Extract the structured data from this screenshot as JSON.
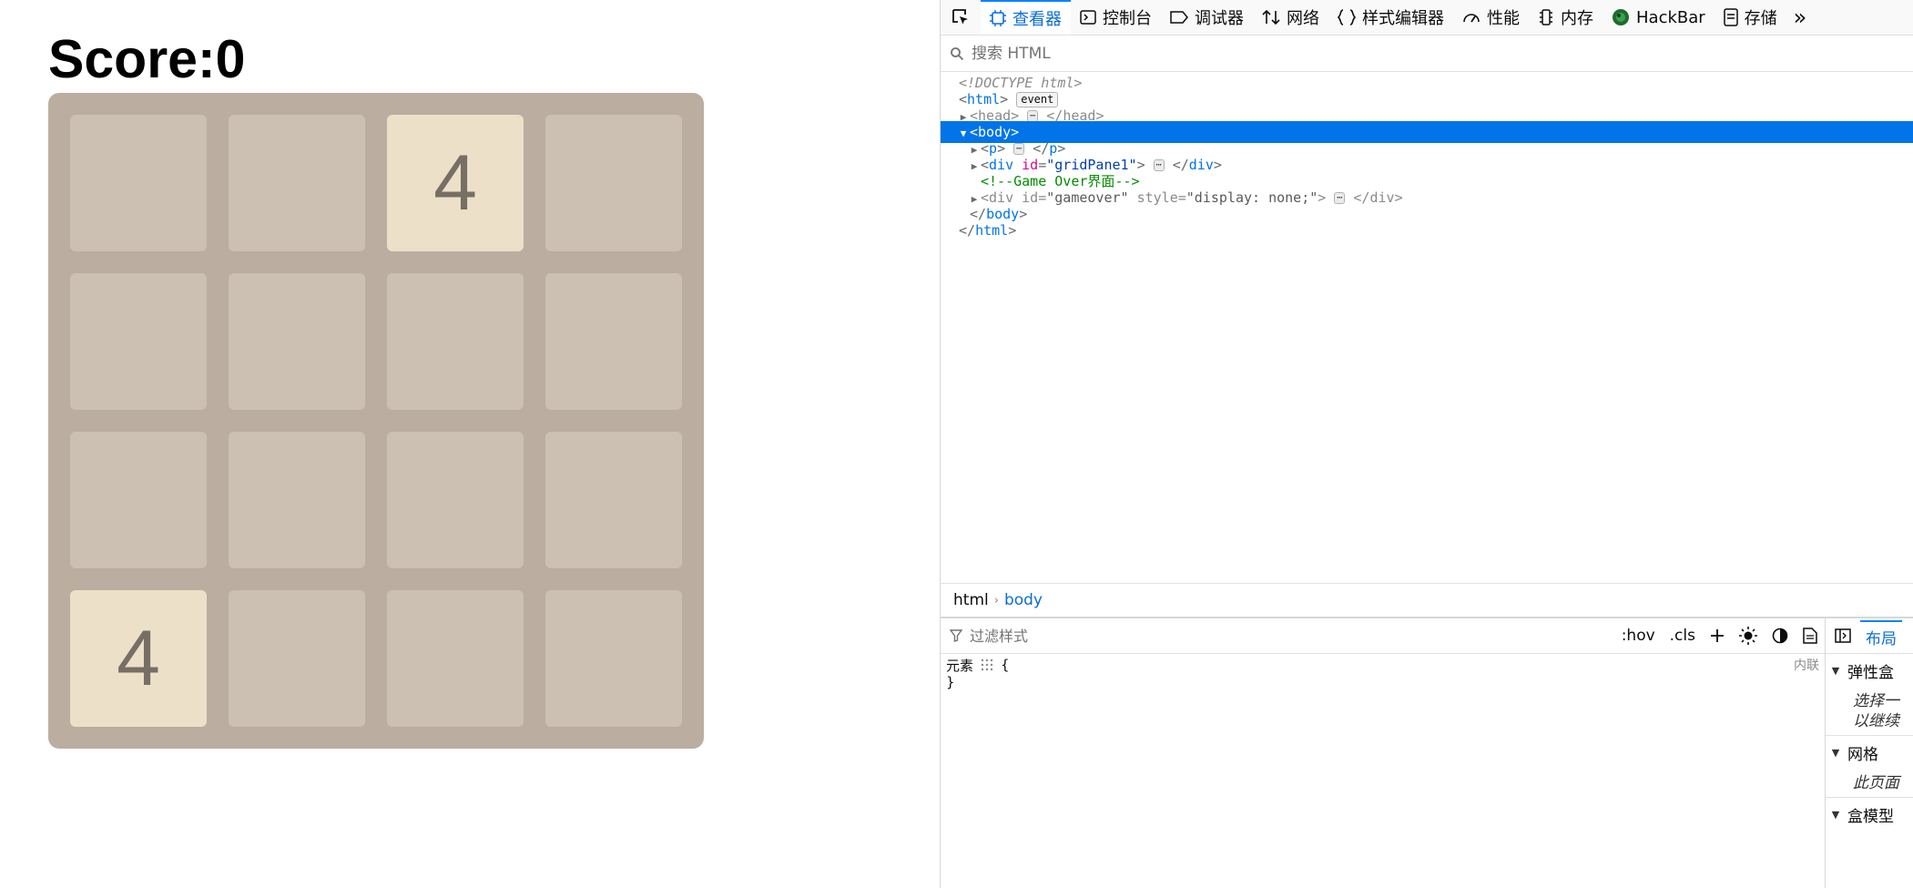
{
  "game": {
    "score_label": "Score:0",
    "tiles": [
      "",
      "",
      "4",
      "",
      "",
      "",
      "",
      "",
      "",
      "",
      "",
      "",
      "4",
      "",
      "",
      ""
    ]
  },
  "devtools": {
    "tabs": [
      {
        "label": "查看器",
        "icon": "inspector-icon",
        "active": true
      },
      {
        "label": "控制台",
        "icon": "console-icon",
        "active": false
      },
      {
        "label": "调试器",
        "icon": "debugger-icon",
        "active": false
      },
      {
        "label": "网络",
        "icon": "network-icon",
        "active": false
      },
      {
        "label": "样式编辑器",
        "icon": "style-editor-icon",
        "active": false
      },
      {
        "label": "性能",
        "icon": "performance-icon",
        "active": false
      },
      {
        "label": "内存",
        "icon": "memory-icon",
        "active": false
      },
      {
        "label": "HackBar",
        "icon": "hackbar-icon",
        "active": false
      },
      {
        "label": "存储",
        "icon": "storage-icon",
        "active": false
      }
    ],
    "more_label": "»",
    "search_placeholder": "搜索 HTML",
    "tree": {
      "doctype": "<!DOCTYPE html>",
      "html_tag": "html",
      "event_badge": "event",
      "head_tag": "head",
      "body_tag": "body",
      "p_tag": "p",
      "div_tag": "div",
      "id_attr": "id",
      "style_attr": "style",
      "grid_id": "\"gridPane1\"",
      "comment": "<!--Game Over界面-->",
      "gameover_id": "\"gameover\"",
      "gameover_style": "\"display: none;\"",
      "dots": "⋯"
    },
    "breadcrumbs": [
      "html",
      "body"
    ],
    "rules": {
      "filter_placeholder": "过滤样式",
      "hov": ":hov",
      "cls": ".cls",
      "element_label": "元素",
      "open_brace": "{",
      "close_brace": "}",
      "inline_label": "内联"
    },
    "side": {
      "active_tab": "布局",
      "flex_title": "弹性盒",
      "flex_hint_1": "选择一",
      "flex_hint_2": "以继续",
      "grid_title": "网格",
      "grid_hint": "此页面",
      "box_title": "盒模型"
    },
    "colors": {
      "accent": "#0a84ff",
      "selection": "#0074e8"
    }
  }
}
